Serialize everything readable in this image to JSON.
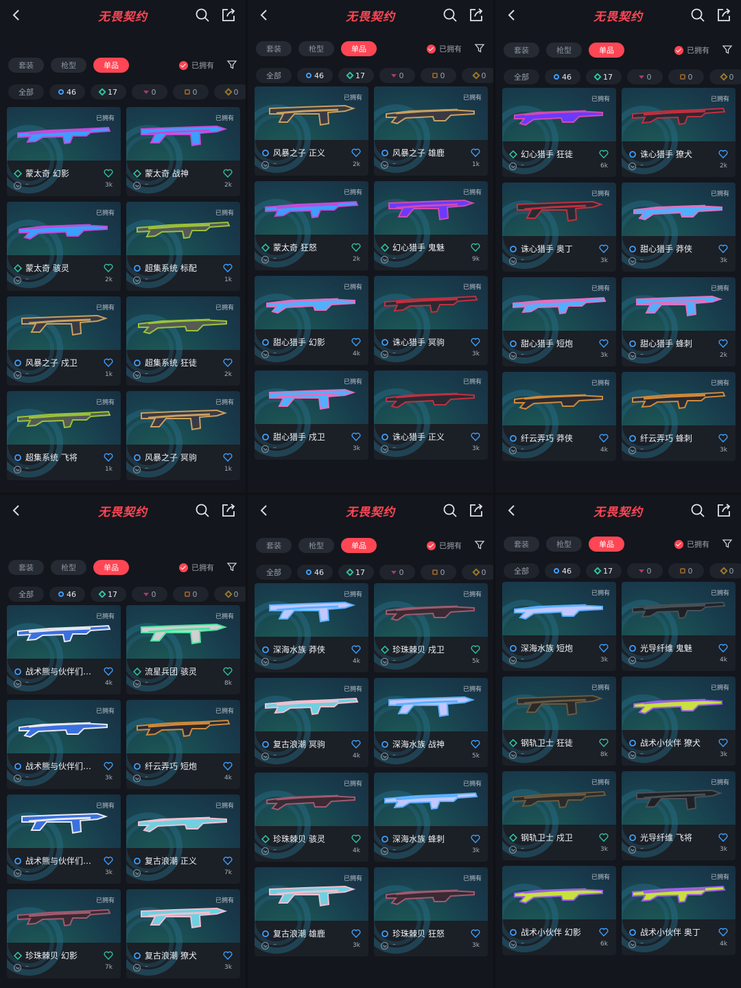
{
  "header": {
    "logo": "无畏契约"
  },
  "tabs": [
    "套装",
    "枪型",
    "单品"
  ],
  "owned_filter": "已拥有",
  "chips": [
    {
      "label": "全部",
      "kind": "all"
    },
    {
      "label": "46",
      "kind": "b"
    },
    {
      "label": "17",
      "kind": "g"
    },
    {
      "label": "0",
      "kind": "p"
    },
    {
      "label": "0",
      "kind": "o"
    },
    {
      "label": "0",
      "kind": "y"
    }
  ],
  "owned_tag": "已拥有",
  "equip_text": "–",
  "colors": {
    "accent": "#ff4655",
    "tier_blue": "#3da0ff",
    "tier_green": "#2ec4a0",
    "bg": "#13161c",
    "card": "#1b1f26"
  },
  "panels": [
    {
      "cards": [
        {
          "name": "蒙太奇 幻影",
          "tier": "green",
          "count": "3k",
          "gun": [
            "#c04bd8",
            "#3aa0ff"
          ]
        },
        {
          "name": "蒙太奇 战神",
          "tier": "green",
          "count": "2k",
          "gun": [
            "#c04bd8",
            "#3aa0ff"
          ]
        },
        {
          "name": "蒙太奇 骇灵",
          "tier": "green",
          "count": "2k",
          "gun": [
            "#c04bd8",
            "#3aa0ff"
          ]
        },
        {
          "name": "超集系统 标配",
          "tier": "blue",
          "count": "1k",
          "gun": [
            "#9ac23a",
            "#555a55"
          ]
        },
        {
          "name": "风暴之子 戍卫",
          "tier": "blue",
          "count": "1k",
          "gun": [
            "#c8a060",
            "#3a3a44"
          ]
        },
        {
          "name": "超集系统 狂徒",
          "tier": "blue",
          "count": "2k",
          "gun": [
            "#9ac23a",
            "#555a55"
          ]
        },
        {
          "name": "超集系统 飞将",
          "tier": "blue",
          "count": "1k",
          "gun": [
            "#9ac23a",
            "#555a55"
          ]
        },
        {
          "name": "风暴之子 冥驹",
          "tier": "blue",
          "count": "1k",
          "gun": [
            "#c8a060",
            "#3a3a44"
          ]
        }
      ]
    },
    {
      "cards": [
        {
          "name": "风暴之子 正义",
          "tier": "blue",
          "count": "2k",
          "gun": [
            "#c8a060",
            "#3a3a44"
          ]
        },
        {
          "name": "风暴之子 雄鹿",
          "tier": "blue",
          "count": "1k",
          "gun": [
            "#c8a060",
            "#3a3a44"
          ]
        },
        {
          "name": "蒙太奇 狂怒",
          "tier": "green",
          "count": "2k",
          "gun": [
            "#c04bd8",
            "#3aa0ff"
          ]
        },
        {
          "name": "幻心猎手 鬼魅",
          "tier": "green",
          "count": "9k",
          "gun": [
            "#d04ab0",
            "#6a3aff"
          ]
        },
        {
          "name": "甜心猎手 幻影",
          "tier": "blue",
          "count": "4k",
          "gun": [
            "#e070c0",
            "#50b0ff"
          ]
        },
        {
          "name": "诛心猎手 冥驹",
          "tier": "blue",
          "count": "3k",
          "gun": [
            "#c03040",
            "#2a2a33"
          ]
        },
        {
          "name": "甜心猎手 戍卫",
          "tier": "blue",
          "count": "3k",
          "gun": [
            "#e070c0",
            "#50b0ff"
          ]
        },
        {
          "name": "诛心猎手 正义",
          "tier": "blue",
          "count": "3k",
          "gun": [
            "#c03040",
            "#2a2a33"
          ]
        }
      ]
    },
    {
      "cards": [
        {
          "name": "幻心猎手 狂徒",
          "tier": "green",
          "count": "6k",
          "gun": [
            "#d04ab0",
            "#6a3aff"
          ]
        },
        {
          "name": "诛心猎手 獠犬",
          "tier": "blue",
          "count": "2k",
          "gun": [
            "#c03040",
            "#2a2a33"
          ]
        },
        {
          "name": "诛心猎手 奥丁",
          "tier": "blue",
          "count": "3k",
          "gun": [
            "#c03040",
            "#2a2a33"
          ]
        },
        {
          "name": "甜心猎手 莽侠",
          "tier": "blue",
          "count": "3k",
          "gun": [
            "#e070c0",
            "#50b0ff"
          ]
        },
        {
          "name": "甜心猎手 短炮",
          "tier": "blue",
          "count": "3k",
          "gun": [
            "#e070c0",
            "#50b0ff"
          ]
        },
        {
          "name": "甜心猎手 蜂刺",
          "tier": "blue",
          "count": "2k",
          "gun": [
            "#e070c0",
            "#50b0ff"
          ]
        },
        {
          "name": "纤云弄巧 莽侠",
          "tier": "blue",
          "count": "4k",
          "gun": [
            "#d08a3a",
            "#2a2a33"
          ]
        },
        {
          "name": "纤云弄巧 蜂刺",
          "tier": "blue",
          "count": "3k",
          "gun": [
            "#d08a3a",
            "#2a2a33"
          ]
        }
      ]
    },
    {
      "cards": [
        {
          "name": "战术熊与伙伴们…",
          "tier": "blue",
          "count": "4k",
          "gun": [
            "#e8e8f0",
            "#3a70e0"
          ]
        },
        {
          "name": "流星兵团 骇灵",
          "tier": "green",
          "count": "8k",
          "gun": [
            "#50e0a0",
            "#d0d0d0"
          ]
        },
        {
          "name": "战术熊与伙伴们…",
          "tier": "blue",
          "count": "3k",
          "gun": [
            "#e8e8f0",
            "#3a70e0"
          ]
        },
        {
          "name": "纤云弄巧 短炮",
          "tier": "blue",
          "count": "4k",
          "gun": [
            "#d08a3a",
            "#2a2a33"
          ]
        },
        {
          "name": "战术熊与伙伴们…",
          "tier": "blue",
          "count": "3k",
          "gun": [
            "#e8e8f0",
            "#3a70e0"
          ]
        },
        {
          "name": "复古浪潮 正义",
          "tier": "blue",
          "count": "7k",
          "gun": [
            "#f0c0d0",
            "#70d0e0"
          ]
        },
        {
          "name": "珍珠棘贝 幻影",
          "tier": "green",
          "count": "7k",
          "gun": [
            "#a05a70",
            "#3a2a33"
          ]
        },
        {
          "name": "复古浪潮 獠犬",
          "tier": "blue",
          "count": "3k",
          "gun": [
            "#f0c0d0",
            "#70d0e0"
          ]
        }
      ]
    },
    {
      "cards": [
        {
          "name": "深海水族 莽侠",
          "tier": "blue",
          "count": "4k",
          "gun": [
            "#5ab0ff",
            "#c0c8ff"
          ]
        },
        {
          "name": "珍珠棘贝 戍卫",
          "tier": "green",
          "count": "5k",
          "gun": [
            "#a05a70",
            "#3a2a33"
          ]
        },
        {
          "name": "复古浪潮 冥驹",
          "tier": "blue",
          "count": "4k",
          "gun": [
            "#f0c0d0",
            "#70d0e0"
          ]
        },
        {
          "name": "深海水族 战神",
          "tier": "blue",
          "count": "5k",
          "gun": [
            "#5ab0ff",
            "#c0c8ff"
          ]
        },
        {
          "name": "珍珠棘贝 骇灵",
          "tier": "green",
          "count": "4k",
          "gun": [
            "#a05a70",
            "#3a2a33"
          ]
        },
        {
          "name": "深海水族 蜂刺",
          "tier": "blue",
          "count": "3k",
          "gun": [
            "#5ab0ff",
            "#c0c8ff"
          ]
        },
        {
          "name": "复古浪潮 雄鹿",
          "tier": "blue",
          "count": "3k",
          "gun": [
            "#f0c0d0",
            "#70d0e0"
          ]
        },
        {
          "name": "珍珠棘贝 狂怒",
          "tier": "blue",
          "count": "3k",
          "gun": [
            "#a05a70",
            "#3a2a33"
          ]
        }
      ]
    },
    {
      "cards": [
        {
          "name": "深海水族 短炮",
          "tier": "blue",
          "count": "3k",
          "gun": [
            "#5ab0ff",
            "#c0c8ff"
          ]
        },
        {
          "name": "光导纤维 鬼魅",
          "tier": "blue",
          "count": "4k",
          "gun": [
            "#4a5058",
            "#1e2226"
          ]
        },
        {
          "name": "钢轨卫士 狂徒",
          "tier": "green",
          "count": "8k",
          "gun": [
            "#6a5a40",
            "#2a2a2a"
          ]
        },
        {
          "name": "战术小伙伴 獠犬",
          "tier": "blue",
          "count": "3k",
          "gun": [
            "#9a60e0",
            "#c8e040"
          ]
        },
        {
          "name": "钢轨卫士 戍卫",
          "tier": "green",
          "count": "3k",
          "gun": [
            "#6a5a40",
            "#2a2a2a"
          ]
        },
        {
          "name": "光导纤维 飞将",
          "tier": "blue",
          "count": "3k",
          "gun": [
            "#4a5058",
            "#1e2226"
          ]
        },
        {
          "name": "战术小伙伴 幻影",
          "tier": "blue",
          "count": "6k",
          "gun": [
            "#9a60e0",
            "#c8e040"
          ]
        },
        {
          "name": "战术小伙伴 奥丁",
          "tier": "blue",
          "count": "4k",
          "gun": [
            "#9a60e0",
            "#c8e040"
          ]
        }
      ]
    }
  ]
}
